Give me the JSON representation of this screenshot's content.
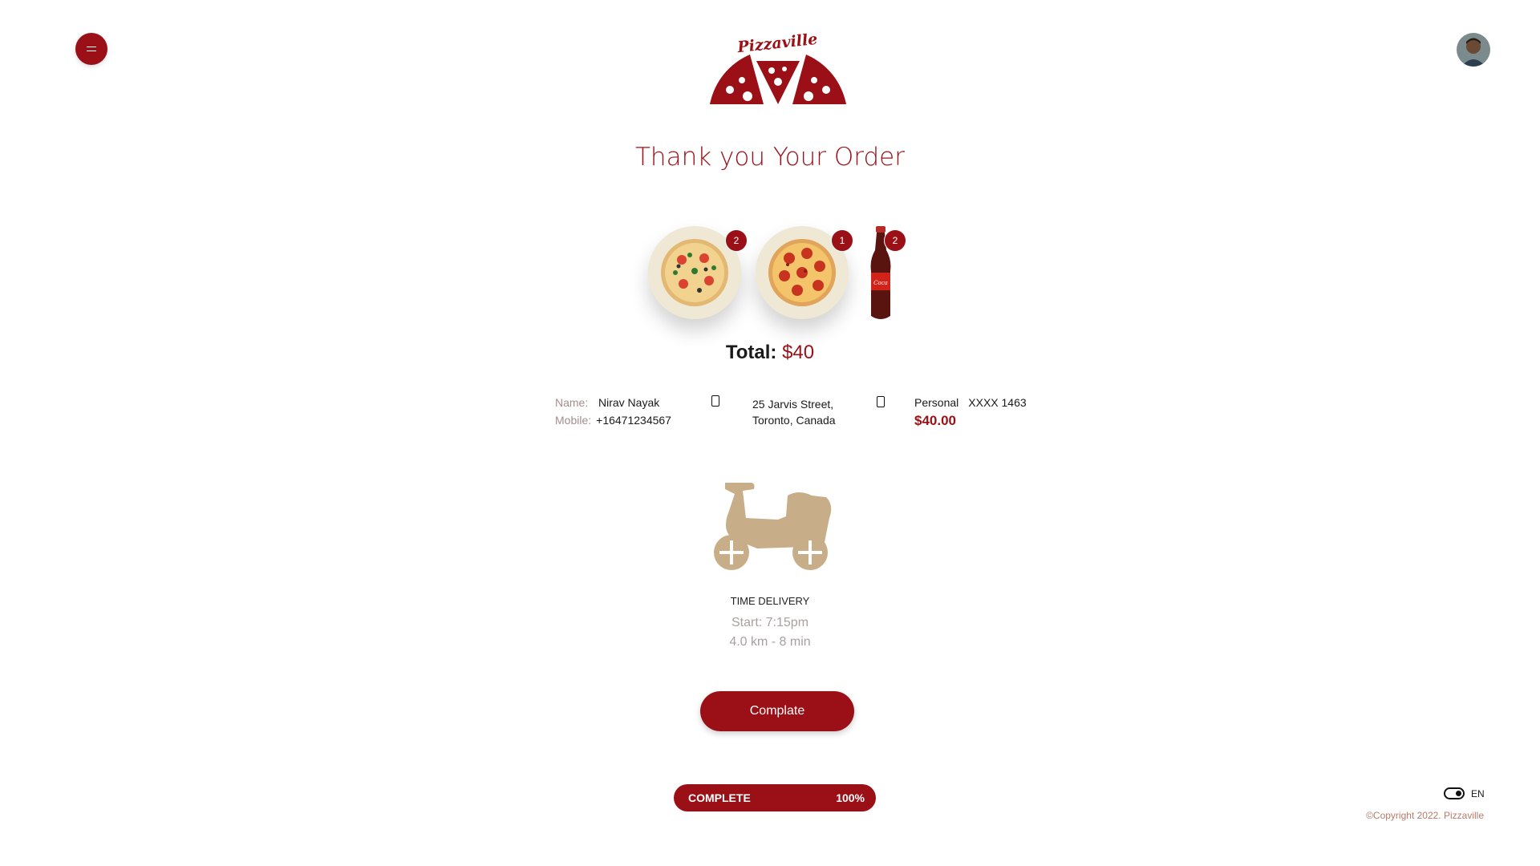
{
  "brand": {
    "name": "Pizzaville",
    "color": "#9b1016"
  },
  "header": {
    "menu_icon": "menu-icon",
    "avatar": "user-avatar"
  },
  "page": {
    "title": "Thank you Your Order"
  },
  "items": [
    {
      "name": "Veggie Pizza",
      "icon": "veggie-pizza-icon",
      "qty": "2"
    },
    {
      "name": "Pepperoni Pizza",
      "icon": "pepperoni-pizza-icon",
      "qty": "1"
    },
    {
      "name": "Cola Bottle",
      "icon": "cola-bottle-icon",
      "qty": "2"
    }
  ],
  "total": {
    "label": "Total:",
    "value": "$40"
  },
  "customer": {
    "name_label": "Name:",
    "name": "Nirav Nayak",
    "mobile_label": "Mobile:",
    "mobile": "+16471234567"
  },
  "address": {
    "line1": "25 Jarvis Street,",
    "line2": "Toronto, Canada"
  },
  "payment": {
    "type": "Personal",
    "card": "XXXX 1463",
    "amount": "$40.00"
  },
  "delivery": {
    "title": "TIME DELIVERY",
    "start_label": "Start:",
    "start_time": "7:15pm",
    "distance": "4.0 km - 8 min"
  },
  "actions": {
    "complete_label": "Complate"
  },
  "progress": {
    "label": "COMPLETE",
    "percent_text": "100%",
    "percent": 100
  },
  "footer": {
    "language": "EN",
    "copyright": "©Copyright 2022. Pizzaville"
  }
}
